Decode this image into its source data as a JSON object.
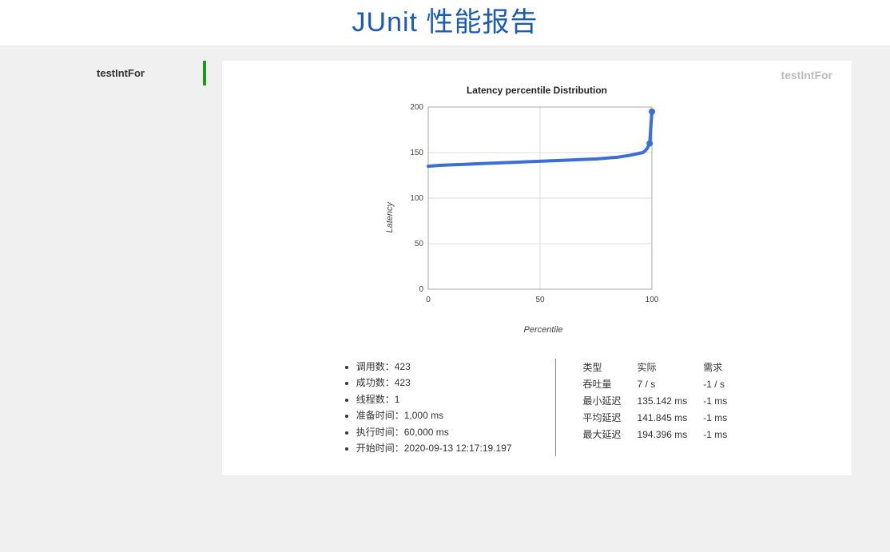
{
  "header": {
    "title": "JUnit 性能报告"
  },
  "sidebar": {
    "items": [
      {
        "label": "testIntFor"
      }
    ]
  },
  "main": {
    "testName": "testIntFor",
    "stats_left": {
      "invocations_label": "调用数：",
      "invocations_value": "423",
      "success_label": "成功数：",
      "success_value": "423",
      "threads_label": "线程数：",
      "threads_value": "1",
      "warmup_label": "准备时间：",
      "warmup_value": "1,000 ms",
      "exec_label": "执行时间：",
      "exec_value": "60,000 ms",
      "start_label": "开始时间：",
      "start_value": "2020-09-13 12:17:19.197"
    },
    "stats_right": {
      "col_type": "类型",
      "col_actual": "实际",
      "col_required": "需求",
      "throughput_label": "吞吐量",
      "throughput_actual": "7 / s",
      "throughput_required": "-1 / s",
      "min_label": "最小延迟",
      "min_actual": "135.142 ms",
      "min_required": "-1 ms",
      "avg_label": "平均延迟",
      "avg_actual": "141.845 ms",
      "avg_required": "-1 ms",
      "max_label": "最大延迟",
      "max_actual": "194.396 ms",
      "max_required": "-1 ms"
    }
  },
  "chart_data": {
    "type": "line",
    "title": "Latency percentile Distribution",
    "xlabel": "Percentile",
    "ylabel": "Latency",
    "xlim": [
      0,
      100
    ],
    "ylim": [
      0,
      200
    ],
    "x_ticks": [
      0,
      50,
      100
    ],
    "y_ticks": [
      0,
      50,
      100,
      150,
      200
    ],
    "series": [
      {
        "name": "latency",
        "x": [
          0,
          5,
          10,
          15,
          20,
          25,
          30,
          35,
          40,
          45,
          50,
          55,
          60,
          65,
          70,
          75,
          80,
          85,
          90,
          92,
          94,
          96,
          97,
          98,
          99,
          100
        ],
        "values": [
          135,
          136,
          136.5,
          137,
          137.5,
          138,
          138.5,
          139,
          139.5,
          140,
          140.5,
          141,
          141.5,
          142,
          142.5,
          143,
          144,
          145,
          147,
          148,
          149,
          150,
          152,
          155,
          160,
          195
        ]
      }
    ]
  }
}
